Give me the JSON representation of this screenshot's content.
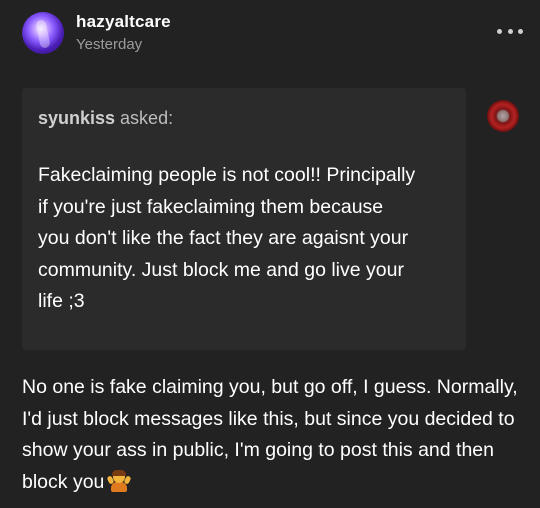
{
  "post": {
    "author": "hazyaltcare",
    "timestamp": "Yesterday",
    "more_icon": "more-horizontal-icon"
  },
  "ask": {
    "asker": "syunkiss",
    "asked_label": " asked:",
    "text": "Fakeclaiming people is not cool!! Principally\nif you're just fakeclaiming them because\nyou don't like the fact they are agaisnt your\ncommunity. Just block me and go live your\nlife ;3"
  },
  "answer": {
    "text": "No one is fake claiming you, but go off, I guess. Normally, I'd just block messages like this, but since you decided to show your ass in public, I'm going to post this and then block you",
    "emoji": "person-shrugging-emoji"
  },
  "colors": {
    "background": "#222222",
    "ask_background": "#2b2b2b",
    "muted_text": "#9c9c9c"
  }
}
